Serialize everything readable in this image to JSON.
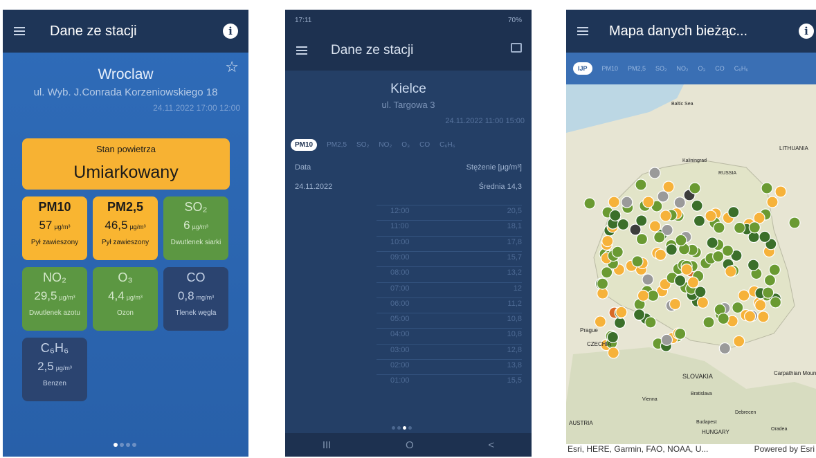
{
  "screen1": {
    "title": "Dane ze stacji",
    "info_glyph": "i",
    "city": "Wroclaw",
    "address": "ul. Wyb. J.Conrada Korzeniowskiego 18",
    "timestamp": "24.11.2022 17:00 12:00",
    "air_quality": {
      "heading": "Stan powietrza",
      "value": "Umiarkowany"
    },
    "tiles": [
      {
        "name": "PM10",
        "value": "57",
        "unit": "µg/m³",
        "desc": "Pył zawieszony",
        "color": "yellow"
      },
      {
        "name": "PM2,5",
        "value": "46,5",
        "unit": "µg/m³",
        "desc": "Pył zawieszony",
        "color": "yellow"
      },
      {
        "name": "SO₂",
        "value": "6",
        "unit": "µg/m³",
        "desc": "Dwutlenek siarki",
        "color": "green"
      },
      {
        "name": "NO₂",
        "value": "29,5",
        "unit": "µg/m³",
        "desc": "Dwutlenek azotu",
        "color": "green"
      },
      {
        "name": "O₃",
        "value": "4,4",
        "unit": "µg/m³",
        "desc": "Ozon",
        "color": "green"
      },
      {
        "name": "CO",
        "value": "0,8",
        "unit": "mg/m³",
        "desc": "Tlenek węgla",
        "color": "dark"
      },
      {
        "name": "C₆H₆",
        "value": "2,5",
        "unit": "µg/m³",
        "desc": "Benzen",
        "color": "dark"
      }
    ]
  },
  "screen2": {
    "status_time": "17:11",
    "status_right": "70%",
    "title": "Dane ze stacji",
    "city": "Kielce",
    "address": "ul. Targowa 3",
    "timestamp": "24.11.2022 11:00 15:00",
    "pollutant_tabs": [
      "PM10",
      "PM2,5",
      "SO₂",
      "NO₂",
      "O₃",
      "CO",
      "C₆H₆"
    ],
    "header_date": "Data",
    "header_conc": "Stężenie [µg/m³]",
    "date": "24.11.2022",
    "average": "Średnia 14,3",
    "rows": [
      {
        "hour": "12:00",
        "value": "20,5"
      },
      {
        "hour": "11:00",
        "value": "18,1"
      },
      {
        "hour": "10:00",
        "value": "17,8"
      },
      {
        "hour": "09:00",
        "value": "15,7"
      },
      {
        "hour": "08:00",
        "value": "13,2"
      },
      {
        "hour": "07:00",
        "value": "12"
      },
      {
        "hour": "06:00",
        "value": "11,2"
      },
      {
        "hour": "05:00",
        "value": "10,8"
      },
      {
        "hour": "04:00",
        "value": "10,8"
      },
      {
        "hour": "03:00",
        "value": "12,8"
      },
      {
        "hour": "02:00",
        "value": "13,8"
      },
      {
        "hour": "01:00",
        "value": "15,5"
      }
    ],
    "nav": [
      "III",
      "O",
      "<"
    ]
  },
  "screen3": {
    "title": "Mapa danych bieżąc...",
    "info_glyph": "i",
    "pollutant_tabs": [
      "IJP",
      "PM10",
      "PM2,5",
      "SO₂",
      "NO₂",
      "O₃",
      "CO",
      "C₆H₆"
    ],
    "map_labels": [
      "Baltic Sea",
      "Kaliningrad",
      "RUSSIA",
      "LITHUANIA",
      "Prague",
      "CZECHIA",
      "SLOVAKIA",
      "Bratislava",
      "Vienna",
      "Budapest",
      "HUNGARY",
      "Debrecen",
      "Oradea",
      "AUSTRIA",
      "Carpathian Mountains"
    ],
    "attribution": "Esri, HERE, Garmin, FAO, NOAA, U...",
    "powered_by": "Powered by Esri"
  },
  "colors": {
    "good": "#6a9a32",
    "very_good": "#3b6f2a",
    "moderate": "#f6b23a",
    "bad": "#d86a27",
    "no_data": "#9a9a9a",
    "offline": "#3d3d3d"
  }
}
